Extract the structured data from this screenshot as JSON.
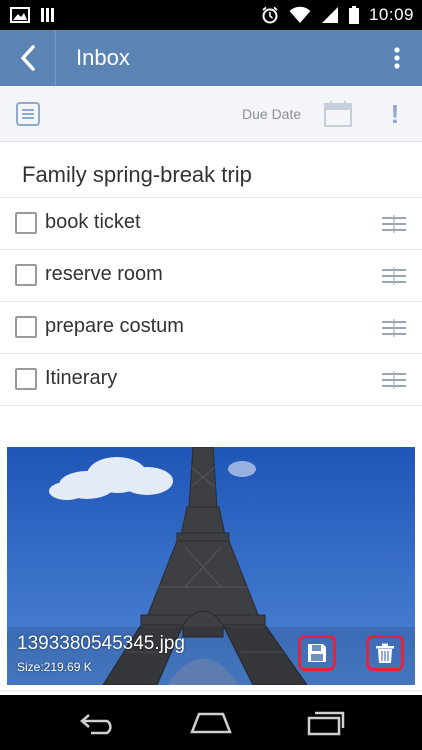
{
  "status_bar": {
    "time": "10:09",
    "icons": [
      "image-icon",
      "signal-bars-icon",
      "alarm-icon",
      "wifi-icon",
      "cell-signal-icon",
      "battery-icon"
    ]
  },
  "app_bar": {
    "title": "Inbox",
    "color": "#5b84b5"
  },
  "toolbar": {
    "due_date_label": "Due Date",
    "priority_label": "!"
  },
  "note": {
    "title": "Family spring-break trip",
    "checklist": [
      {
        "label": "book ticket",
        "checked": false
      },
      {
        "label": "reserve room",
        "checked": false
      },
      {
        "label": "prepare costum",
        "checked": false
      },
      {
        "label": "Itinerary",
        "checked": false
      }
    ]
  },
  "attachment": {
    "file_name": "1393380545345.jpg",
    "size": "Size:219.69 K",
    "highlight_color": "#e3243f"
  },
  "nav_bar": {
    "buttons": [
      "back-icon",
      "home-icon",
      "recents-icon"
    ]
  }
}
